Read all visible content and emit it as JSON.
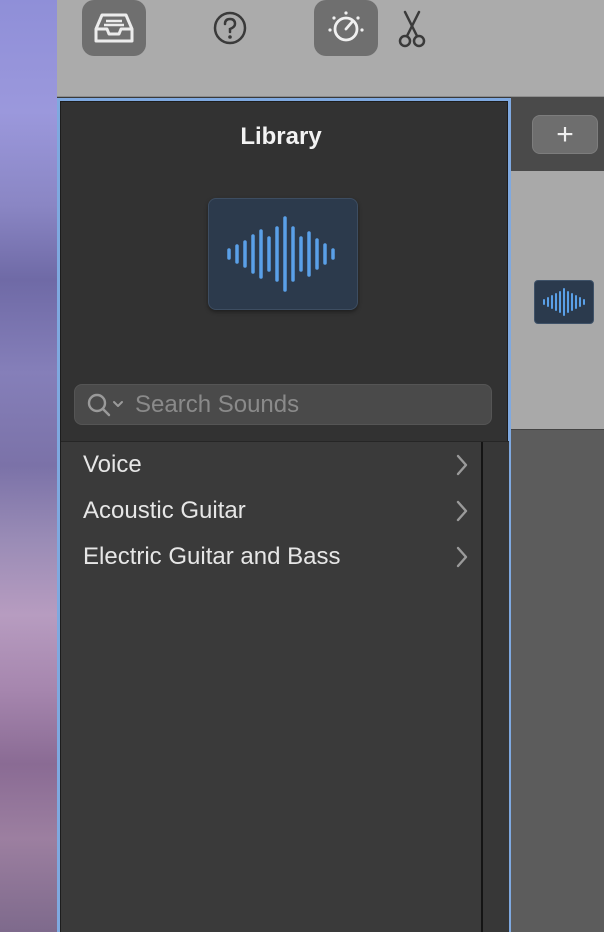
{
  "toolbar": {
    "buttons": [
      {
        "icon": "inbox-tray-icon",
        "active": true
      },
      {
        "icon": "help-icon",
        "active": false
      },
      {
        "icon": "tuner-knob-icon",
        "active": true
      },
      {
        "icon": "scissors-icon",
        "active": false
      }
    ]
  },
  "library": {
    "title": "Library",
    "tile_icon": "waveform-icon",
    "search": {
      "placeholder": "Search Sounds",
      "value": ""
    },
    "items": [
      {
        "label": "Voice"
      },
      {
        "label": "Acoustic Guitar"
      },
      {
        "label": "Electric Guitar and Bass"
      }
    ]
  },
  "tracks": {
    "add_label": "+",
    "track_icon": "waveform-icon"
  },
  "colors": {
    "accent_border": "#7fa9e0",
    "waveform": "#5aa0e8",
    "panel_bg": "#323232",
    "toolbar_bg": "#ababab"
  }
}
